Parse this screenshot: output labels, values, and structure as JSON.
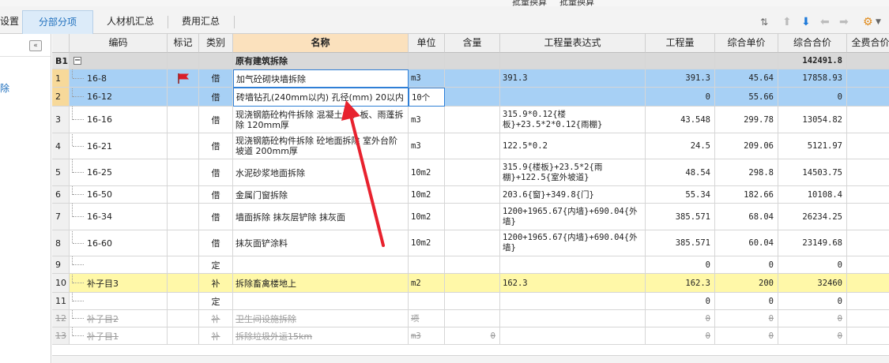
{
  "top_header": {
    "text_a": "批量换算",
    "text_b": "批量换算"
  },
  "tabs": [
    {
      "label": "设置"
    },
    {
      "label": "分部分项"
    },
    {
      "label": "人材机汇总"
    },
    {
      "label": "费用汇总"
    }
  ],
  "left_panel": {
    "collapse_glyph": "«",
    "item_label": "除"
  },
  "columns": {
    "code": "编码",
    "mark": "标记",
    "type": "类别",
    "name": "名称",
    "unit": "单位",
    "content": "含量",
    "expr": "工程量表达式",
    "qty": "工程量",
    "unit_price": "综合单价",
    "total": "综合合价",
    "full_price": "全费合价"
  },
  "section": {
    "id": "B1",
    "expander": "−",
    "name": "原有建筑拆除",
    "total": "142491.8"
  },
  "rows": [
    {
      "num": "1",
      "code": "16-8",
      "type": "借",
      "name": "加气砼砌块墙拆除",
      "unit": "m3",
      "content": "",
      "expr": "391.3",
      "qty": "391.3",
      "unit_price": "45.64",
      "total": "17858.93"
    },
    {
      "num": "2",
      "code": "16-12",
      "type": "借",
      "name": "砖墙钻孔(240mm以内) 孔径(mm) 20以内",
      "unit": "10个",
      "content": "",
      "expr": "",
      "qty": "0",
      "unit_price": "55.66",
      "total": "0"
    },
    {
      "num": "3",
      "code": "16-16",
      "type": "借",
      "name": "现浇钢筋砼构件拆除 混凝土墙、板、雨蓬拆除 120mm厚",
      "unit": "m3",
      "content": "",
      "expr": "315.9*0.12{楼板}+23.5*2*0.12{雨棚}",
      "qty": "43.548",
      "unit_price": "299.78",
      "total": "13054.82"
    },
    {
      "num": "4",
      "code": "16-21",
      "type": "借",
      "name": "现浇钢筋砼构件拆除 砼地面拆除 室外台阶坡道 200mm厚",
      "unit": "m3",
      "content": "",
      "expr": "122.5*0.2",
      "qty": "24.5",
      "unit_price": "209.06",
      "total": "5121.97"
    },
    {
      "num": "5",
      "code": "16-25",
      "type": "借",
      "name": "水泥砂浆地面拆除",
      "unit": "10m2",
      "content": "",
      "expr": "315.9{楼板}+23.5*2{雨棚}+122.5{室外坡道}",
      "qty": "48.54",
      "unit_price": "298.8",
      "total": "14503.75"
    },
    {
      "num": "6",
      "code": "16-50",
      "type": "借",
      "name": "金属门窗拆除",
      "unit": "10m2",
      "content": "",
      "expr": "203.6{窗}+349.8{门}",
      "qty": "55.34",
      "unit_price": "182.66",
      "total": "10108.4"
    },
    {
      "num": "7",
      "code": "16-34",
      "type": "借",
      "name": "墙面拆除 抹灰层铲除 抹灰面",
      "unit": "10m2",
      "content": "",
      "expr": "1200+1965.67{内墙}+690.04{外墙}",
      "qty": "385.571",
      "unit_price": "68.04",
      "total": "26234.25"
    },
    {
      "num": "8",
      "code": "16-60",
      "type": "借",
      "name": "抹灰面铲涂料",
      "unit": "10m2",
      "content": "",
      "expr": "1200+1965.67{内墙}+690.04{外墙}",
      "qty": "385.571",
      "unit_price": "60.04",
      "total": "23149.68"
    },
    {
      "num": "9",
      "code": "",
      "type": "定",
      "name": "",
      "unit": "",
      "content": "",
      "expr": "",
      "qty": "0",
      "unit_price": "0",
      "total": "0"
    },
    {
      "num": "10",
      "code": "补子目3",
      "type": "补",
      "name": "拆除畜禽楼地上",
      "unit": "m2",
      "content": "",
      "expr": "162.3",
      "qty": "162.3",
      "unit_price": "200",
      "total": "32460"
    },
    {
      "num": "11",
      "code": "",
      "type": "定",
      "name": "",
      "unit": "",
      "content": "",
      "expr": "",
      "qty": "0",
      "unit_price": "0",
      "total": "0"
    },
    {
      "num": "12",
      "code": "补子目2",
      "type": "补",
      "name": "卫生间设施拆除",
      "unit": "项",
      "content": "",
      "expr": "",
      "qty": "0",
      "unit_price": "0",
      "total": "0"
    },
    {
      "num": "13",
      "code": "补子目1",
      "type": "补",
      "name": "拆除垃圾外运15km",
      "unit": "m3",
      "content": "0",
      "expr": "",
      "qty": "0",
      "unit_price": "0",
      "total": "0"
    }
  ],
  "colors": {
    "selected": "#a7d0f5",
    "highlight": "#fff8a8",
    "section": "#d9d9d9",
    "name_header": "#fbe1bd",
    "arrow": "#e8222e",
    "flag": "#d91e2a"
  }
}
